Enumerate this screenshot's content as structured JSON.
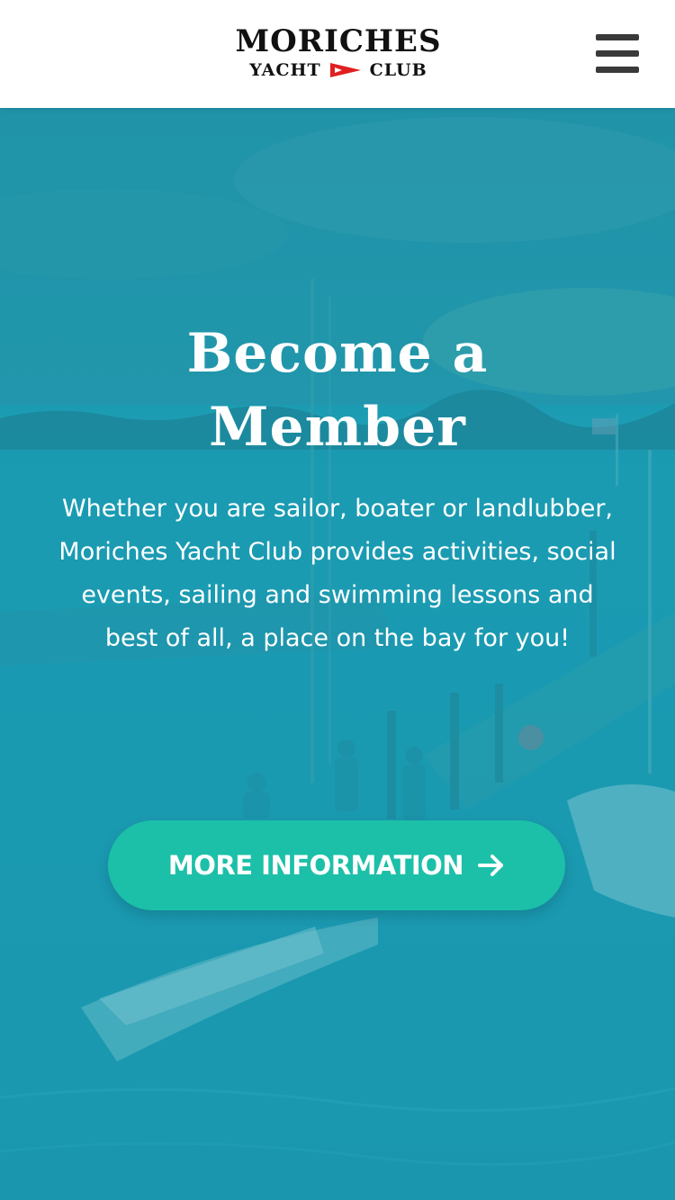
{
  "header": {
    "logo_line1": "MORICHES",
    "logo_yacht": "YACHT",
    "logo_club": "CLUB",
    "menu_icon": "hamburger-menu-icon"
  },
  "hero": {
    "title_line1": "Become a",
    "title_line2": "Member",
    "description": "Whether you are sailor, boater or landlubber, Moriches Yacht Club provides activities, social events, sailing and swimming lessons and best of all, a place on the bay for you!",
    "cta_label": "MORE INFORMATION",
    "cta_icon": "arrow-right-icon"
  },
  "colors": {
    "overlay": "#1c9db4",
    "cta": "#1cc0a8",
    "burgee": "#e02020",
    "text": "#ffffff"
  }
}
